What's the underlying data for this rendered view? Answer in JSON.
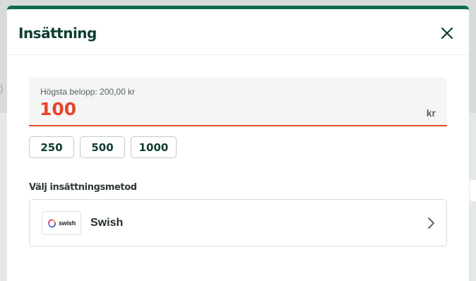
{
  "modal": {
    "title": "Insättning"
  },
  "amount": {
    "label": "Högsta belopp: 200,00 kr",
    "value": "100",
    "unit": "kr"
  },
  "quick_amounts": [
    "250",
    "500",
    "1000"
  ],
  "method_section": {
    "label": "Välj insättningsmetod",
    "methods": [
      {
        "name": "Swish",
        "logo_text": "swish",
        "icon": "swish-logo-icon"
      }
    ]
  },
  "colors": {
    "accent_top": "#0b6b4b",
    "amount_red": "#e5472a",
    "title_green": "#0f3d33"
  },
  "icons": {
    "close": "close-icon",
    "chevron": "chevron-right-icon"
  }
}
